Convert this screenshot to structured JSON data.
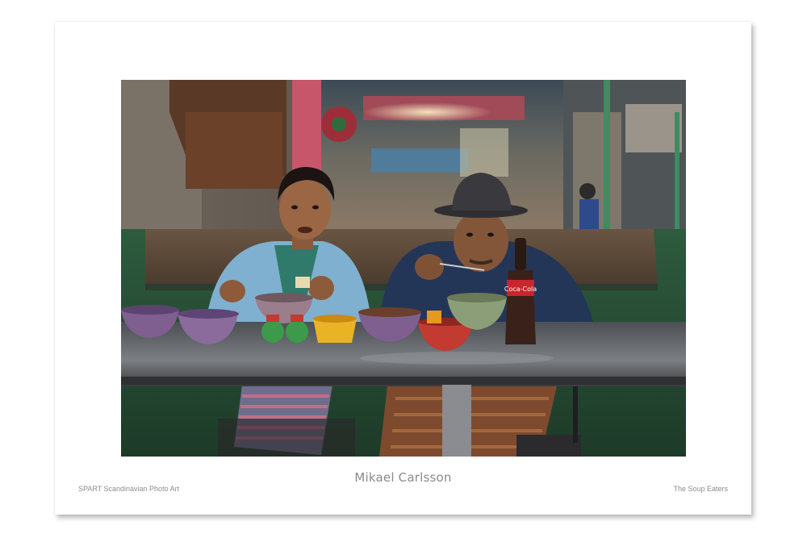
{
  "poster": {
    "photographer": "Mikael Carlsson",
    "publisher": "SPART Scandinavian Photo Art",
    "title": "The Soup Eaters"
  },
  "photo": {
    "subject": "two people eating soup at a metal table in a market",
    "bottle_label": "Coca-Cola"
  },
  "colors": {
    "poster_bg": "#ffffff",
    "caption_text": "#8a8a8a",
    "table_steel": "#6d6f72",
    "bowl_purple": "#7e5f8f",
    "bowl_yellow": "#e9b326",
    "bowl_red": "#c23a30",
    "bowl_green": "#8b9e77",
    "jacket_blue": "#7fb0cf",
    "sweater_navy": "#243658"
  }
}
